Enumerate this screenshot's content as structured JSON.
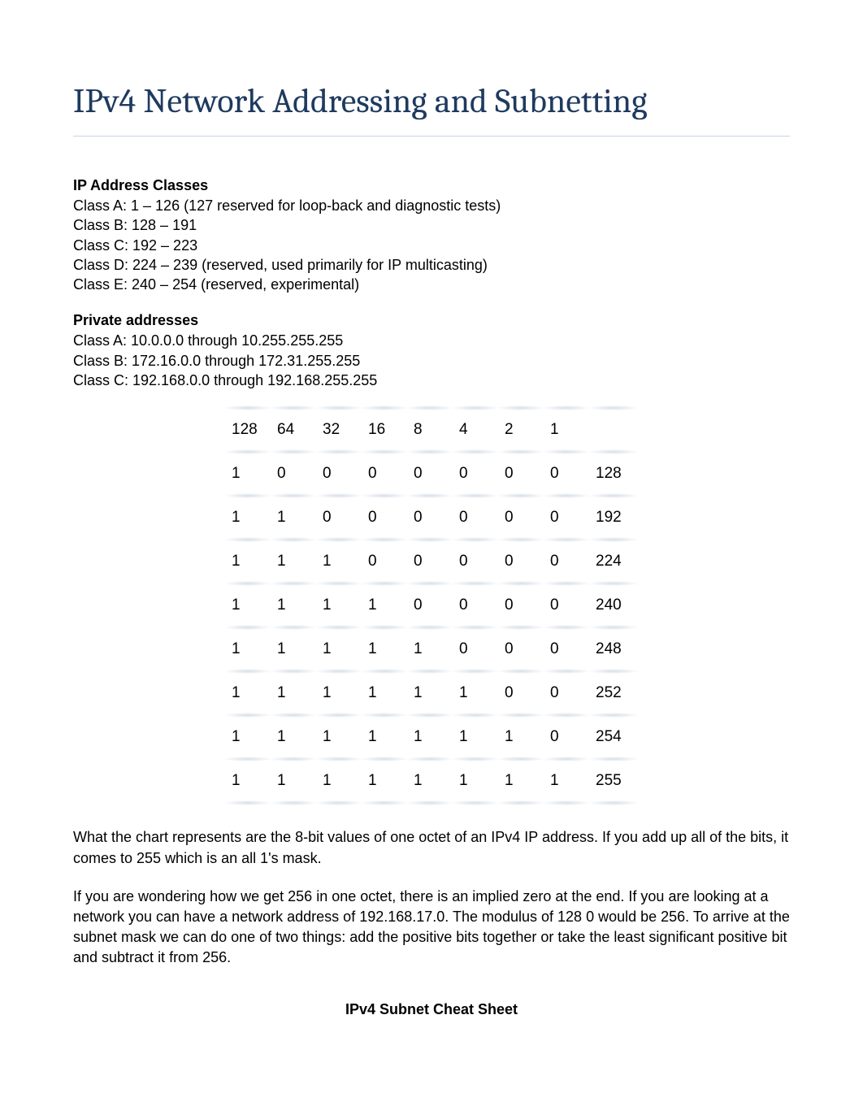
{
  "title": "IPv4 Network Addressing and Subnetting",
  "sections": {
    "ip_classes": {
      "heading": "IP Address Classes",
      "lines": [
        "Class A: 1 – 126 (127 reserved for loop-back and diagnostic tests)",
        "Class B: 128 – 191",
        "Class C: 192 – 223",
        "Class D: 224 – 239 (reserved, used primarily for IP multicasting)",
        "Class E: 240 – 254 (reserved, experimental)"
      ]
    },
    "private": {
      "heading": "Private addresses",
      "lines": [
        "Class A: 10.0.0.0 through 10.255.255.255",
        "Class B: 172.16.0.0 through 172.31.255.255",
        "Class C: 192.168.0.0 through 192.168.255.255"
      ]
    }
  },
  "chart_data": {
    "type": "table",
    "header": [
      "128",
      "64",
      "32",
      "16",
      "8",
      "4",
      "2",
      "1",
      ""
    ],
    "rows": [
      [
        "1",
        "0",
        "0",
        "0",
        "0",
        "0",
        "0",
        "0",
        "128"
      ],
      [
        "1",
        "1",
        "0",
        "0",
        "0",
        "0",
        "0",
        "0",
        "192"
      ],
      [
        "1",
        "1",
        "1",
        "0",
        "0",
        "0",
        "0",
        "0",
        "224"
      ],
      [
        "1",
        "1",
        "1",
        "1",
        "0",
        "0",
        "0",
        "0",
        "240"
      ],
      [
        "1",
        "1",
        "1",
        "1",
        "1",
        "0",
        "0",
        "0",
        "248"
      ],
      [
        "1",
        "1",
        "1",
        "1",
        "1",
        "1",
        "0",
        "0",
        "252"
      ],
      [
        "1",
        "1",
        "1",
        "1",
        "1",
        "1",
        "1",
        "0",
        "254"
      ],
      [
        "1",
        "1",
        "1",
        "1",
        "1",
        "1",
        "1",
        "1",
        "255"
      ]
    ]
  },
  "paragraphs": {
    "p1": "What the chart represents are the 8-bit values of one octet of an IPv4 IP address. If you add up all of the bits, it comes to 255 which is an all 1's mask.",
    "p2": "If you are wondering how we get 256 in one octet, there is an implied zero at the end. If you are looking at a network you can have a network address of 192.168.17.0. The modulus of 128   0 would be 256. To arrive at the subnet mask we can do one of two things: add the positive bits together or take the least significant positive bit and subtract it from 256."
  },
  "footer_heading": "IPv4 Subnet Cheat Sheet"
}
